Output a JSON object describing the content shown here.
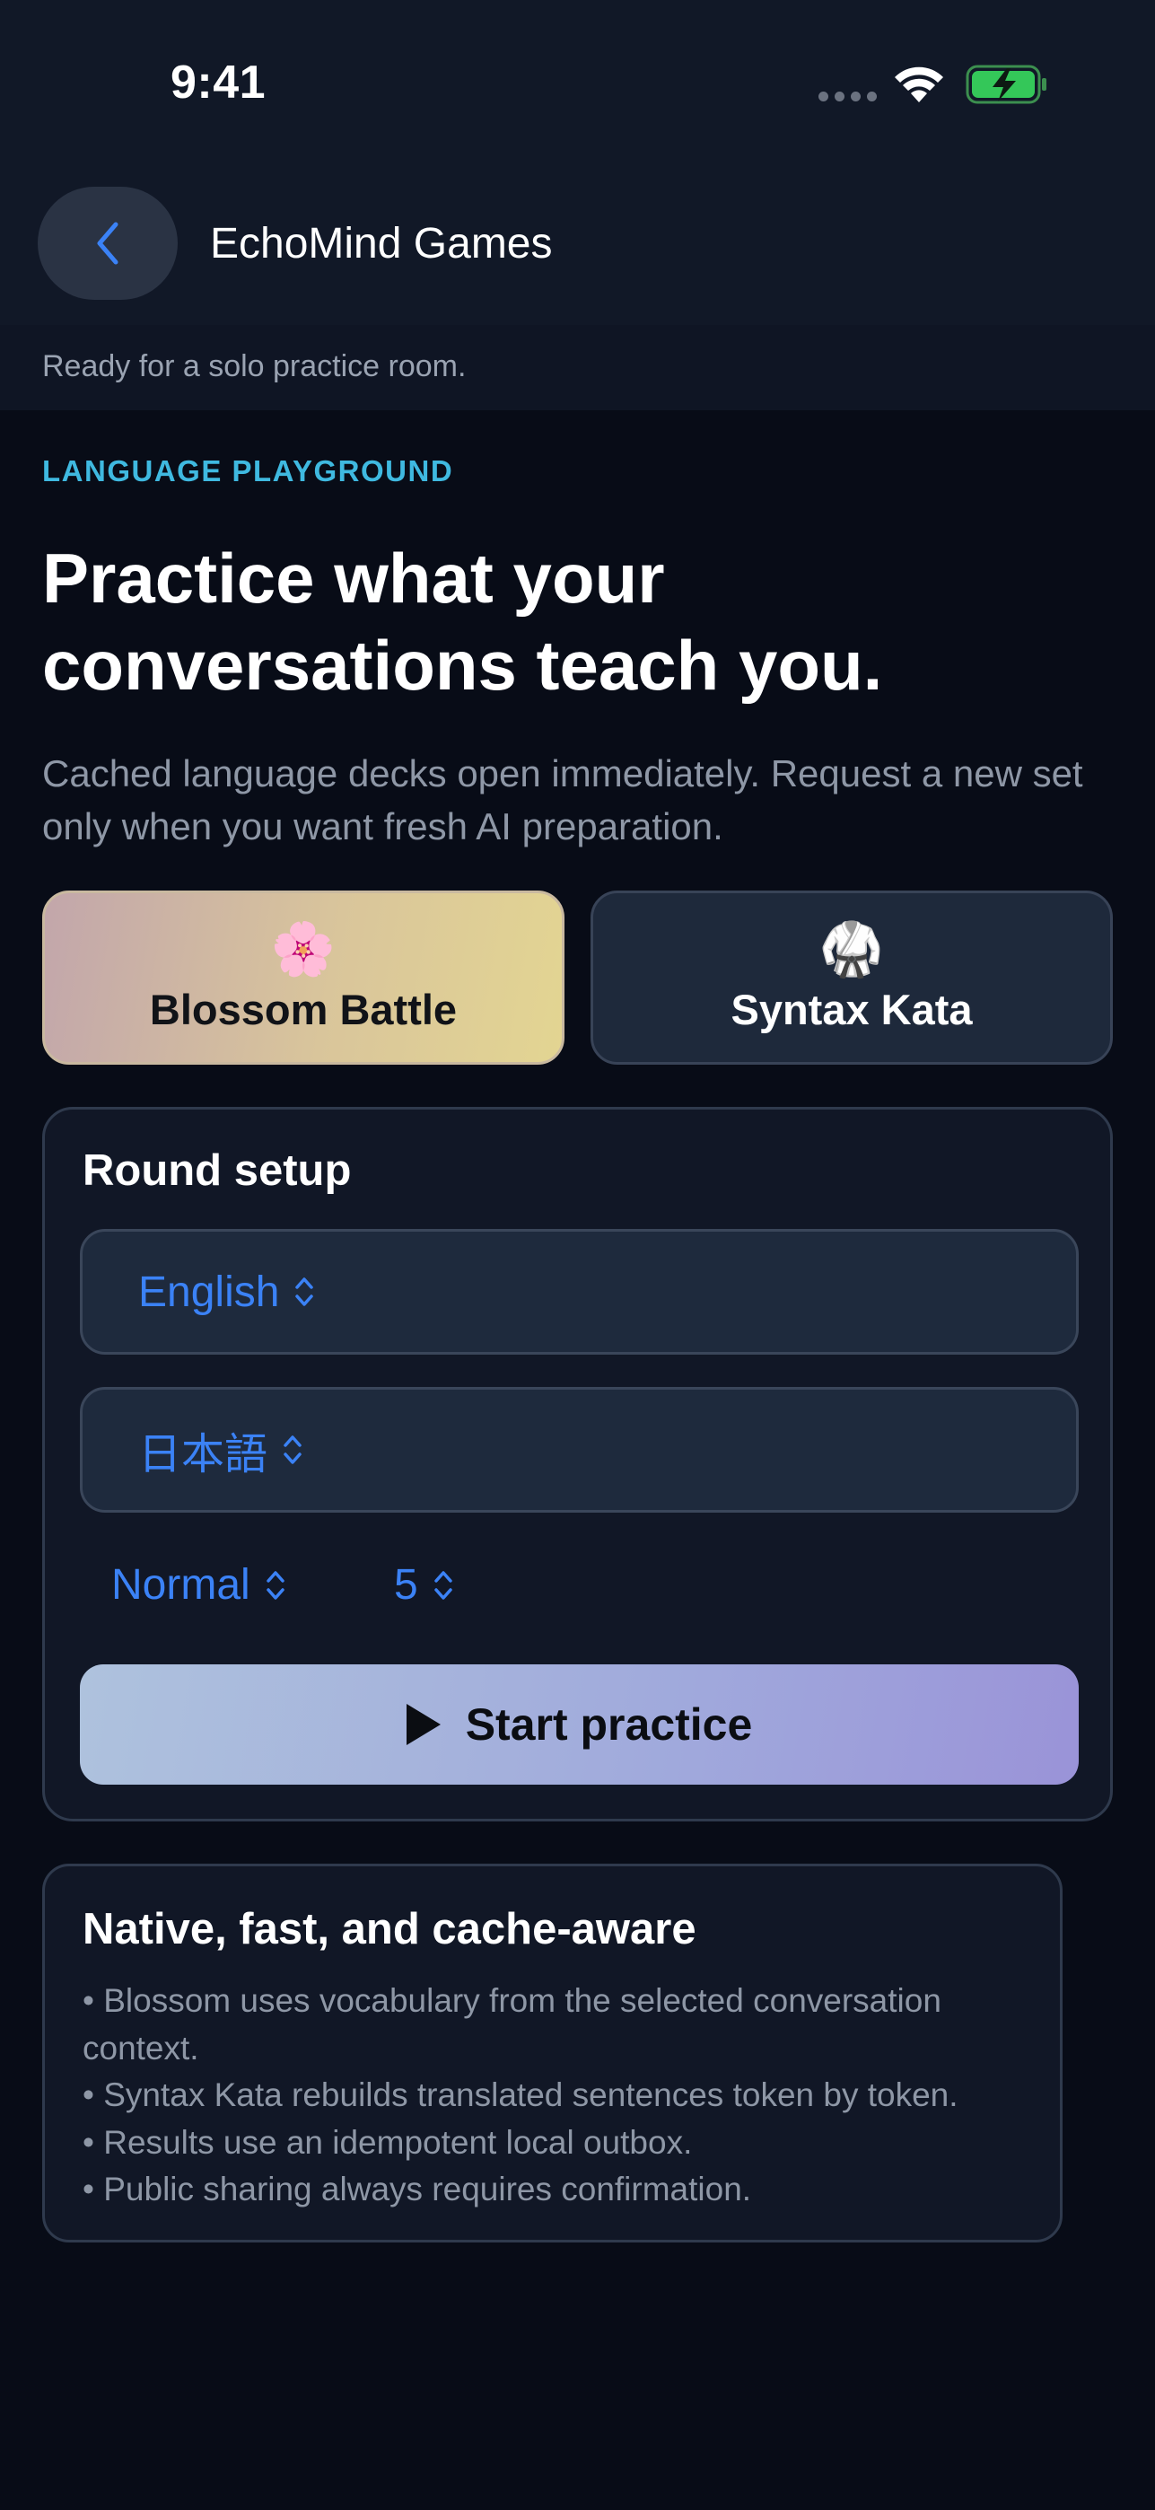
{
  "status_bar": {
    "time": "9:41"
  },
  "nav": {
    "title": "EchoMind Games"
  },
  "subtitle_bar": {
    "text": "Ready for a solo practice room."
  },
  "hero": {
    "eyebrow": "LANGUAGE PLAYGROUND",
    "headline": "Practice what your conversations teach you.",
    "lede": "Cached language decks open immediately. Request a new set only when you want fresh AI preparation."
  },
  "games": [
    {
      "emoji": "🌸",
      "label": "Blossom Battle",
      "selected": true
    },
    {
      "emoji": "🥋",
      "label": "Syntax Kata",
      "selected": false
    }
  ],
  "round_setup": {
    "title": "Round setup",
    "source_language": "English",
    "target_language": "日本語",
    "difficulty": "Normal",
    "count": "5",
    "start_label": "Start practice"
  },
  "info": {
    "title": "Native, fast, and cache-aware",
    "bullets": [
      "• Blossom uses vocabulary from the selected conversation context.",
      "• Syntax Kata rebuilds translated sentences token by token.",
      "• Results use an idempotent local outbox.",
      "• Public sharing always requires confirmation."
    ]
  },
  "colors": {
    "accent_blue": "#3b82f6",
    "eyebrow_cyan": "#3fb9e0",
    "background": "#080c17",
    "battery_green": "#34c759"
  }
}
